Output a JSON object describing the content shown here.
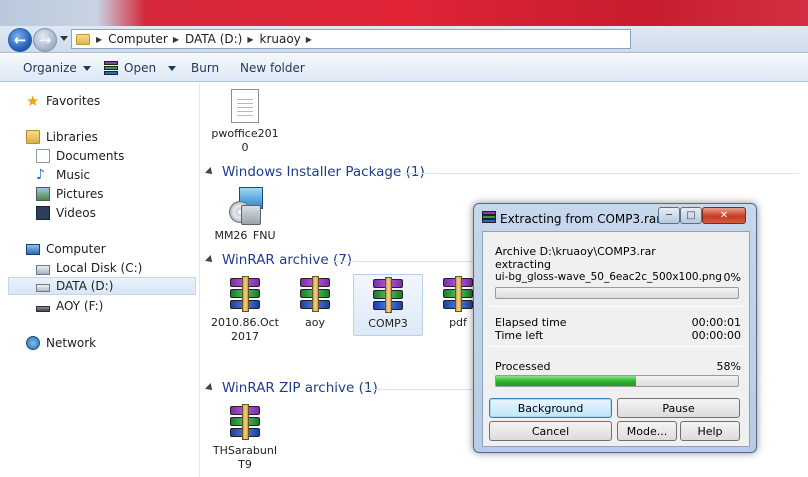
{
  "address": {
    "crumbs": [
      "Computer",
      "DATA (D:)",
      "kruaoy"
    ]
  },
  "toolbar": {
    "organize": "Organize",
    "open": "Open",
    "burn": "Burn",
    "new_folder": "New folder"
  },
  "nav": {
    "favorites": "Favorites",
    "libraries": "Libraries",
    "documents": "Documents",
    "music": "Music",
    "pictures": "Pictures",
    "videos": "Videos",
    "computer": "Computer",
    "local_disk": "Local Disk (C:)",
    "data": "DATA (D:)",
    "aoy": "AOY (F:)",
    "network": "Network"
  },
  "content": {
    "top_file": "pwoffice2010",
    "groups": [
      {
        "title": "Windows Installer Package (1)",
        "files": [
          "MM26_FNU"
        ]
      },
      {
        "title": "WinRAR archive (7)",
        "files": [
          "2010.86.Oct 2017",
          "aoy",
          "COMP3",
          "pdf"
        ]
      },
      {
        "title": "WinRAR ZIP archive (1)",
        "files": [
          "THSarabunIT9"
        ]
      }
    ]
  },
  "dialog": {
    "title": "Extracting from COMP3.rar",
    "archive": "Archive D:\\kruaoy\\COMP3.rar",
    "action": "extracting",
    "file": "ui-bg_gloss-wave_50_6eac2c_500x100.png",
    "file_percent": "0%",
    "elapsed_label": "Elapsed time",
    "elapsed_value": "00:00:01",
    "timeleft_label": "Time left",
    "timeleft_value": "00:00:00",
    "processed_label": "Processed",
    "processed_percent": "58%",
    "progress": {
      "file": 0,
      "processed": 58
    },
    "buttons": {
      "background": "Background",
      "pause": "Pause",
      "cancel": "Cancel",
      "mode": "Mode...",
      "help": "Help"
    }
  },
  "colors": {
    "group_header": "#1e3d8f",
    "progress_fill": "#2fb52f",
    "title_red": "#e02436"
  }
}
